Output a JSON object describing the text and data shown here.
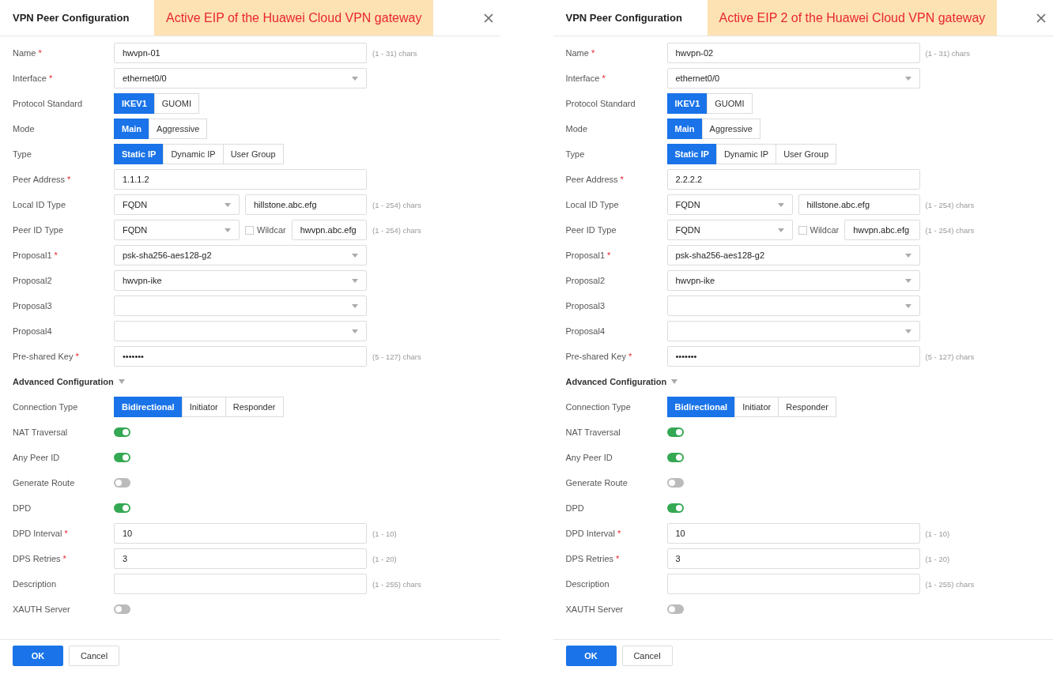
{
  "panels": [
    {
      "title": "VPN Peer Configuration",
      "callout": "Active EIP of the Huawei Cloud VPN gateway",
      "fields": [
        {
          "kind": "text",
          "label": "Name",
          "mark": "*",
          "value": "hwvpn-01",
          "hint": "(1 - 31) chars"
        },
        {
          "kind": "select",
          "label": "Interface",
          "mark": "*",
          "value": "ethernet0/0"
        },
        {
          "kind": "segmented",
          "label": "Protocol Standard",
          "options": [
            {
              "label": "IKEV1",
              "selected": true
            },
            {
              "label": "GUOMI",
              "selected": false
            }
          ]
        },
        {
          "kind": "segmented",
          "label": "Mode",
          "options": [
            {
              "label": "Main",
              "selected": true
            },
            {
              "label": "Aggressive",
              "selected": false
            }
          ]
        },
        {
          "kind": "segmented",
          "label": "Type",
          "options": [
            {
              "label": "Static IP",
              "selected": true
            },
            {
              "label": "Dynamic IP",
              "selected": false
            },
            {
              "label": "User Group",
              "selected": false
            }
          ]
        },
        {
          "kind": "text",
          "label": "Peer Address",
          "mark": "*",
          "value": "1.1.1.2"
        },
        {
          "kind": "id",
          "label": "Local ID Type",
          "value": "FQDN",
          "id_value": "hillstone.abc.efg",
          "hint": "(1 - 254) chars"
        },
        {
          "kind": "id",
          "label": "Peer ID Type",
          "value": "FQDN",
          "wildcard": {
            "label": "Wildcar",
            "checked": false
          },
          "id_value": "hwvpn.abc.efg",
          "hint": "(1 - 254) chars"
        },
        {
          "kind": "select",
          "label": "Proposal1",
          "mark": "*",
          "value": "psk-sha256-aes128-g2"
        },
        {
          "kind": "select",
          "label": "Proposal2",
          "value": "hwvpn-ike"
        },
        {
          "kind": "select",
          "label": "Proposal3"
        },
        {
          "kind": "select",
          "label": "Proposal4"
        },
        {
          "kind": "text",
          "label": "Pre-shared Key",
          "mark": "*",
          "value": "•••••••",
          "hint": "(5 - 127) chars"
        },
        {
          "kind": "section",
          "label": "Advanced Configuration",
          "expanded": true
        },
        {
          "kind": "segmented",
          "label": "Connection Type",
          "options": [
            {
              "label": "Bidirectional",
              "selected": true
            },
            {
              "label": "Initiator",
              "selected": false
            },
            {
              "label": "Responder",
              "selected": false
            }
          ]
        },
        {
          "kind": "toggle",
          "label": "NAT Traversal",
          "on": true
        },
        {
          "kind": "toggle",
          "label": "Any Peer ID",
          "on": true
        },
        {
          "kind": "toggle",
          "label": "Generate Route",
          "on": false
        },
        {
          "kind": "toggle",
          "label": "DPD",
          "on": true
        },
        {
          "kind": "text",
          "label": "DPD Interval",
          "mark": "*",
          "value": "10",
          "hint": "(1 - 10)"
        },
        {
          "kind": "text",
          "label": "DPS Retries",
          "mark": "*",
          "value": "3",
          "hint": "(1 - 20)"
        },
        {
          "kind": "text",
          "label": "Description",
          "hint": "(1 - 255) chars"
        },
        {
          "kind": "toggle",
          "label": "XAUTH Server",
          "on": false
        }
      ],
      "buttons": [
        {
          "label": "OK",
          "primary": true
        },
        {
          "label": "Cancel",
          "primary": false
        }
      ]
    },
    {
      "title": "VPN Peer Configuration",
      "callout": "Active EIP 2 of the Huawei Cloud VPN gateway",
      "fields": [
        {
          "kind": "text",
          "label": "Name",
          "mark": "*",
          "value": "hwvpn-02",
          "hint": "(1 - 31) chars"
        },
        {
          "kind": "select",
          "label": "Interface",
          "mark": "*",
          "value": "ethernet0/0"
        },
        {
          "kind": "segmented",
          "label": "Protocol Standard",
          "options": [
            {
              "label": "IKEV1",
              "selected": true
            },
            {
              "label": "GUOMI",
              "selected": false
            }
          ]
        },
        {
          "kind": "segmented",
          "label": "Mode",
          "options": [
            {
              "label": "Main",
              "selected": true
            },
            {
              "label": "Aggressive",
              "selected": false
            }
          ]
        },
        {
          "kind": "segmented",
          "label": "Type",
          "options": [
            {
              "label": "Static IP",
              "selected": true
            },
            {
              "label": "Dynamic IP",
              "selected": false
            },
            {
              "label": "User Group",
              "selected": false
            }
          ]
        },
        {
          "kind": "text",
          "label": "Peer Address",
          "mark": "*",
          "value": "2.2.2.2"
        },
        {
          "kind": "id",
          "label": "Local ID Type",
          "value": "FQDN",
          "id_value": "hillstone.abc.efg",
          "hint": "(1 - 254) chars"
        },
        {
          "kind": "id",
          "label": "Peer ID Type",
          "value": "FQDN",
          "wildcard": {
            "label": "Wildcar",
            "checked": false
          },
          "id_value": "hwvpn.abc.efg",
          "hint": "(1 - 254) chars"
        },
        {
          "kind": "select",
          "label": "Proposal1",
          "mark": "*",
          "value": "psk-sha256-aes128-g2"
        },
        {
          "kind": "select",
          "label": "Proposal2",
          "value": "hwvpn-ike"
        },
        {
          "kind": "select",
          "label": "Proposal3"
        },
        {
          "kind": "select",
          "label": "Proposal4"
        },
        {
          "kind": "text",
          "label": "Pre-shared Key",
          "mark": "*",
          "value": "•••••••",
          "hint": "(5 - 127) chars"
        },
        {
          "kind": "section",
          "label": "Advanced Configuration",
          "expanded": true
        },
        {
          "kind": "segmented",
          "label": "Connection Type",
          "options": [
            {
              "label": "Bidirectional",
              "selected": true
            },
            {
              "label": "Initiator",
              "selected": false
            },
            {
              "label": "Responder",
              "selected": false
            }
          ]
        },
        {
          "kind": "toggle",
          "label": "NAT Traversal",
          "on": true
        },
        {
          "kind": "toggle",
          "label": "Any Peer ID",
          "on": true
        },
        {
          "kind": "toggle",
          "label": "Generate Route",
          "on": false
        },
        {
          "kind": "toggle",
          "label": "DPD",
          "on": true
        },
        {
          "kind": "text",
          "label": "DPD Interval",
          "mark": "*",
          "value": "10",
          "hint": "(1 - 10)"
        },
        {
          "kind": "text",
          "label": "DPS Retries",
          "mark": "*",
          "value": "3",
          "hint": "(1 - 20)"
        },
        {
          "kind": "text",
          "label": "Description",
          "hint": "(1 - 255) chars"
        },
        {
          "kind": "toggle",
          "label": "XAUTH Server",
          "on": false
        }
      ],
      "buttons": [
        {
          "label": "OK",
          "primary": true
        },
        {
          "label": "Cancel",
          "primary": false
        }
      ]
    }
  ]
}
